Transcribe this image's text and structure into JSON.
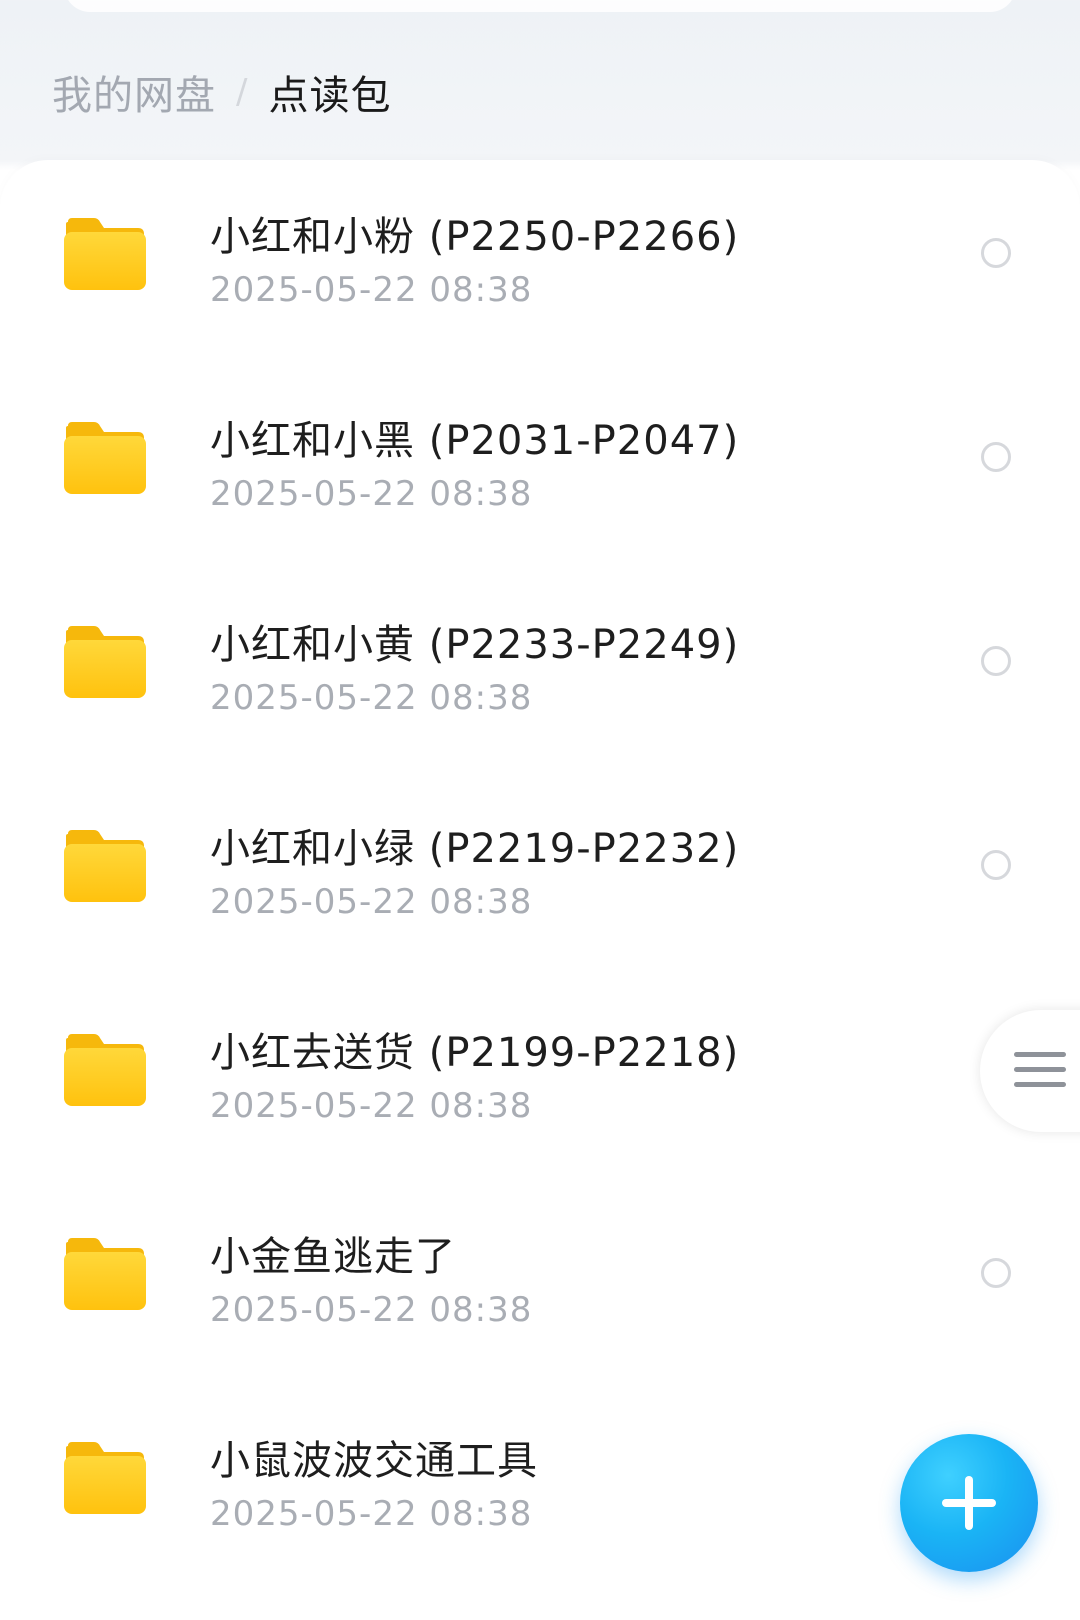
{
  "breadcrumb": {
    "root": "我的网盘",
    "separator": "/",
    "current": "点读包"
  },
  "files": [
    {
      "name": "小红和小粉 (P2250-P2266)",
      "date": "2025-05-22  08:38",
      "icon": "folder-icon"
    },
    {
      "name": "小红和小黑 (P2031-P2047)",
      "date": "2025-05-22  08:38",
      "icon": "folder-icon"
    },
    {
      "name": "小红和小黄 (P2233-P2249)",
      "date": "2025-05-22  08:38",
      "icon": "folder-icon"
    },
    {
      "name": "小红和小绿 (P2219-P2232)",
      "date": "2025-05-22  08:38",
      "icon": "folder-icon"
    },
    {
      "name": "小红去送货 (P2199-P2218)",
      "date": "2025-05-22  08:38",
      "icon": "folder-icon"
    },
    {
      "name": "小金鱼逃走了",
      "date": "2025-05-22  08:38",
      "icon": "folder-icon"
    },
    {
      "name": "小鼠波波交通工具",
      "date": "2025-05-22  08:38",
      "icon": "folder-icon"
    }
  ],
  "side_handle": {
    "icon": "menu-icon"
  },
  "fab": {
    "icon": "plus-icon"
  },
  "colors": {
    "folder_yellow": "#ffcc1a",
    "accent_blue": "#1ab4f5",
    "text_primary": "#1e1e1e",
    "text_secondary": "#a9adb4"
  }
}
